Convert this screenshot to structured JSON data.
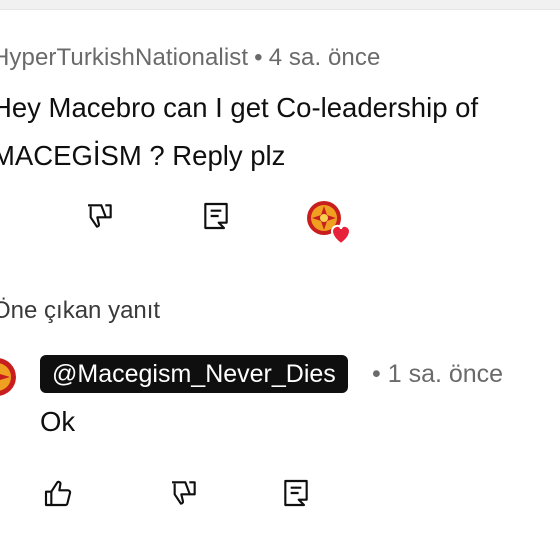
{
  "comment": {
    "author": "HyperTurkishNationalist",
    "separator": "•",
    "time": "4 sa. önce",
    "line1": "Hey Macebro can I get Co-leadership of",
    "line2": "MACEGİSM ? Reply plz"
  },
  "comment_actions": {
    "dislike_icon": "thumbs-down-icon",
    "reply_icon": "reply-comment-icon",
    "creator_heart": "creator-heart-avatar"
  },
  "replies": {
    "header": "Öne çıkan yanıt"
  },
  "reply": {
    "mention": "@Macegism_Never_Dies",
    "separator": "•",
    "time": "1 sa. önce",
    "text": "Ok"
  },
  "reply_actions": {
    "like_icon": "thumbs-up-icon",
    "dislike_icon": "thumbs-down-icon",
    "reply_icon": "reply-comment-icon"
  },
  "colors": {
    "text": "#0f0f0f",
    "meta": "#6a6a6a",
    "chip_bg": "#0f0f0f",
    "chip_text": "#ffffff",
    "heart": "#e8213b",
    "avatar_orange": "#f0a020",
    "avatar_red": "#c81e1e"
  }
}
